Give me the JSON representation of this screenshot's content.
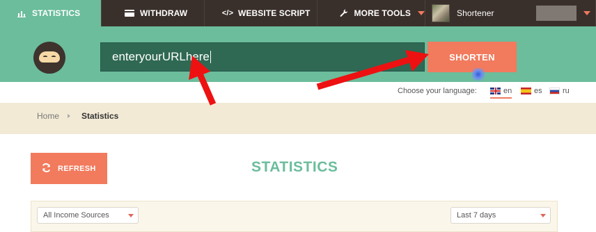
{
  "nav": {
    "items": [
      {
        "label": "STATISTICS",
        "icon": "bar-chart-icon",
        "active": true
      },
      {
        "label": "WITHDRAW",
        "icon": "credit-card-icon"
      },
      {
        "label": "WEBSITE SCRIPT",
        "icon": "code-icon"
      },
      {
        "label": "MORE TOOLS",
        "icon": "wrench-icon"
      }
    ],
    "user": {
      "name": "Shortener"
    }
  },
  "shorten": {
    "input_value": "enteryourURLhere",
    "button_label": "SHORTEN"
  },
  "language": {
    "label": "Choose your language:",
    "options": [
      {
        "code": "en",
        "flag": "uk-flag-icon",
        "selected": true
      },
      {
        "code": "es",
        "flag": "spain-flag-icon"
      },
      {
        "code": "ru",
        "flag": "russia-flag-icon"
      }
    ]
  },
  "breadcrumb": {
    "home": "Home",
    "current": "Statistics"
  },
  "main": {
    "refresh_label": "REFRESH",
    "title": "STATISTICS",
    "filters": {
      "source": "All Income Sources",
      "range": "Last 7 days"
    }
  },
  "colors": {
    "accent_green": "#6bbd9c",
    "accent_orange": "#f27a5d",
    "nav_dark": "#3a302b",
    "annotation_red": "#ee1111"
  }
}
